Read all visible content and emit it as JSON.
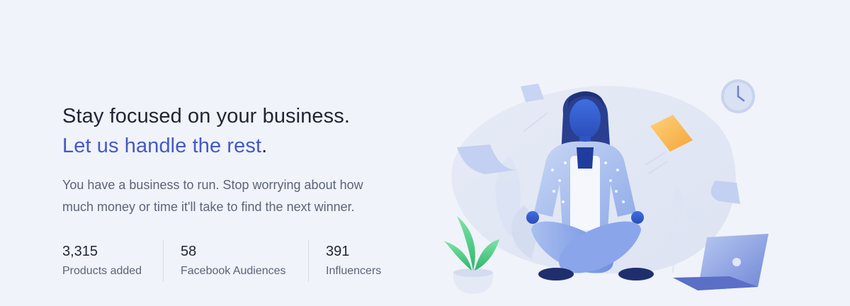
{
  "hero": {
    "headline_line1": "Stay focused on your business.",
    "headline_line2": "Let us handle the rest",
    "headline_period": ".",
    "subtext": "You have a business to run. Stop worrying about how much money or time it'll take to find the next winner."
  },
  "stats": [
    {
      "value": "3,315",
      "label": "Products added"
    },
    {
      "value": "58",
      "label": "Facebook Audiences"
    },
    {
      "value": "391",
      "label": "Influencers"
    }
  ],
  "colors": {
    "background": "#f0f3f9",
    "accent": "#4459c5",
    "text": "#1f2533",
    "muted": "#5b6478"
  },
  "illustration": {
    "icons": [
      "meditating-person-icon",
      "clock-icon",
      "sticky-note-icon",
      "laptop-icon",
      "potted-plant-icon",
      "paper-sheet-icon"
    ]
  }
}
